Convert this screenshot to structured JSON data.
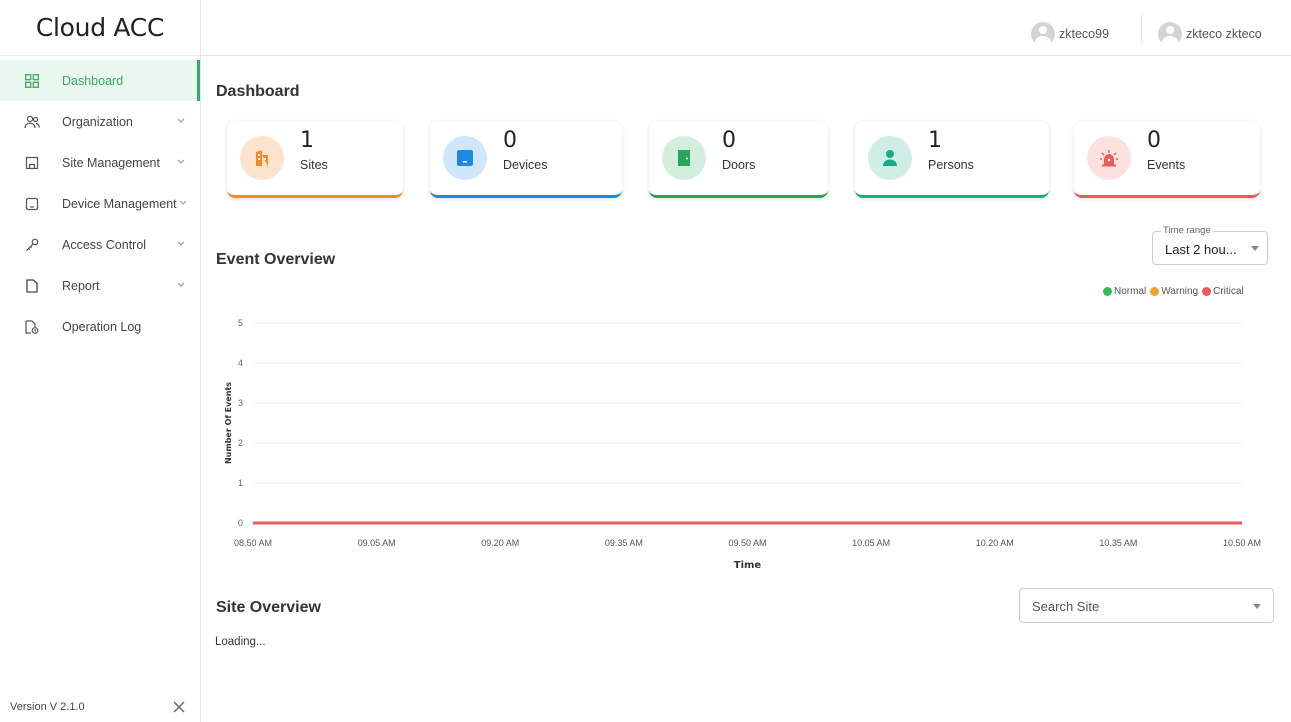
{
  "app": {
    "brand": "Cloud ACC",
    "version": "Version V 2.1.0"
  },
  "header": {
    "users": [
      {
        "name": "zkteco99"
      },
      {
        "name": "zkteco zkteco"
      }
    ]
  },
  "sidebar": {
    "items": [
      {
        "label": "Dashboard",
        "icon": "grid-icon",
        "active": true,
        "chevron": false
      },
      {
        "label": "Organization",
        "icon": "people-icon",
        "chevron": true
      },
      {
        "label": "Site Management",
        "icon": "building-icon",
        "chevron": true
      },
      {
        "label": "Device Management",
        "icon": "device-icon",
        "chevron": true
      },
      {
        "label": "Access Control",
        "icon": "key-icon",
        "chevron": true
      },
      {
        "label": "Report",
        "icon": "document-icon",
        "chevron": true
      },
      {
        "label": "Operation Log",
        "icon": "log-icon",
        "chevron": false
      }
    ]
  },
  "dashboard": {
    "title": "Dashboard",
    "cards": [
      {
        "value": "1",
        "label": "Sites",
        "color": "#f08a2c",
        "bg": "#fde2cc",
        "icon": "building-icon"
      },
      {
        "value": "0",
        "label": "Devices",
        "color": "#1e88e5",
        "bg": "#cfe6fb",
        "icon": "device-icon"
      },
      {
        "value": "0",
        "label": "Doors",
        "color": "#27a55a",
        "bg": "#d3f0de",
        "icon": "door-icon"
      },
      {
        "value": "1",
        "label": "Persons",
        "color": "#1ca988",
        "bg": "#cfeee5",
        "icon": "person-icon"
      },
      {
        "value": "0",
        "label": "Events",
        "color": "#e85c5c",
        "bg": "#fde0e0",
        "icon": "alarm-icon"
      }
    ]
  },
  "event_overview": {
    "title": "Event Overview",
    "time_range": {
      "label": "Time range",
      "value": "Last 2 hou..."
    },
    "legend": [
      {
        "name": "Normal",
        "color": "#2fbf5a"
      },
      {
        "name": "Warning",
        "color": "#f3a32a"
      },
      {
        "name": "Critical",
        "color": "#ee5a5a"
      }
    ]
  },
  "chart_data": {
    "type": "line",
    "title": "",
    "xlabel": "Time",
    "ylabel": "Number Of Events",
    "x": [
      "08.50 AM",
      "09.05 AM",
      "09.20 AM",
      "09.35 AM",
      "09.50 AM",
      "10.05 AM",
      "10.20 AM",
      "10.35 AM",
      "10.50 AM"
    ],
    "ylim": [
      0,
      5
    ],
    "yticks": [
      0,
      1,
      2,
      3,
      4,
      5
    ],
    "grid": true,
    "legend_position": "top-right",
    "series": [
      {
        "name": "Normal",
        "color": "#2fbf5a",
        "values": [
          0,
          0,
          0,
          0,
          0,
          0,
          0,
          0,
          0
        ]
      },
      {
        "name": "Warning",
        "color": "#f3a32a",
        "values": [
          0,
          0,
          0,
          0,
          0,
          0,
          0,
          0,
          0
        ]
      },
      {
        "name": "Critical",
        "color": "#ee5a5a",
        "values": [
          0,
          0,
          0,
          0,
          0,
          0,
          0,
          0,
          0
        ]
      }
    ]
  },
  "site_overview": {
    "title": "Site Overview",
    "search_placeholder": "Search Site",
    "status": "Loading..."
  }
}
